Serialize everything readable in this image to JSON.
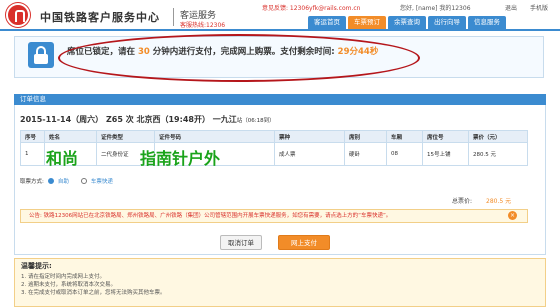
{
  "header": {
    "brand": "中国铁路客户服务中心",
    "sub": "客运服务",
    "hotline": "客服热线:12306",
    "feedback": "意见反馈: 12306yfk@rails.com.cn",
    "greeting": "您好, [name] 我的12306",
    "logout": "退出",
    "mobile": "手机版"
  },
  "nav": [
    {
      "label": "客运首页",
      "active": false
    },
    {
      "label": "车票预订",
      "active": true
    },
    {
      "label": "余票查询",
      "active": false
    },
    {
      "label": "出行向导",
      "active": false
    },
    {
      "label": "信息服务",
      "active": false
    }
  ],
  "lock_notice": {
    "prefix": "席位已锁定，请在",
    "minutes": "30",
    "middle": "分钟内进行支付，完成网上购票。支付剩余时间:",
    "remaining": "29分44秒"
  },
  "order": {
    "panel_title": "订单信息",
    "date": "2015-11-14（周六）",
    "train": "Z65 次",
    "from": "北京西",
    "depart": "（19:48开）",
    "to": "一九江",
    "arrive": "站（06:18到）",
    "columns": [
      "序号",
      "姓名",
      "证件类型",
      "证件号码",
      "票种",
      "席别",
      "车厢",
      "席位号",
      "票价（元）"
    ],
    "rows": [
      {
        "no": "1",
        "name": "",
        "id_type": "二代身份证",
        "id_no": "",
        "ticket_type": "成人票",
        "seat_class": "硬卧",
        "car": "08",
        "seat": "15号上铺",
        "price": "280.5 元"
      }
    ],
    "overlay_name": "和尚",
    "overlay_site": "指南针户外",
    "pay_method_label": "取票方式:",
    "pay_options": [
      "自助",
      "车票快递"
    ],
    "total_label": "总票价:",
    "total_value": "280.5 元",
    "notice": "公告: 铁路12306网站已在北京铁路局、郑州铁路局、广州铁路（集团）公司管辖范围内开展车票快递服务，如您有需要，请点选上方的“车票快递”。",
    "cancel_label": "取消订单",
    "pay_label": "网上支付"
  },
  "tips": {
    "title": "温馨提示:",
    "items": [
      "1. 请在指定时间内完成网上支付。",
      "2. 逾期未支付，系统将取消本次交易。",
      "3. 在完成支付或取消本订单之前，您将无法购买其他车票。"
    ]
  }
}
